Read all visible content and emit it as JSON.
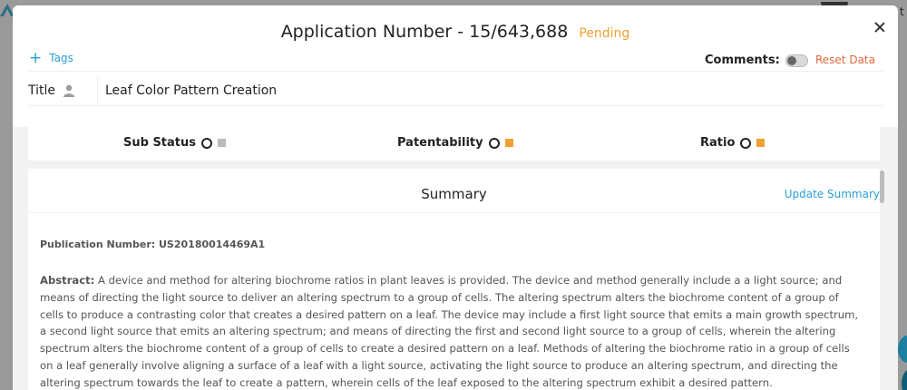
{
  "modal": {
    "title": "Application Number - 15/643,688",
    "status": "Pending",
    "tags_label": "Tags",
    "comments_label": "Comments:",
    "reset_label": "Reset Data",
    "title_label": "Title",
    "title_value": "Leaf Color Pattern Creation"
  },
  "partial_row": {
    "items": [
      "Sub Status",
      "Patentability",
      "Ratio"
    ]
  },
  "summary": {
    "heading": "Summary",
    "update_label": "Update Summary",
    "publication_label": "Publication Number:",
    "publication_value": "US20180014469A1",
    "abstract_label": "Abstract:",
    "abstract_text": "A device and method for altering biochrome ratios in plant leaves is provided. The device and method generally include a a light source; and means of directing the light source to deliver an altering spectrum to a group of cells. The altering spectrum alters the biochrome content of a group of cells to produce a contrasting color that creates a desired pattern on a leaf. The device may include a first light source that emits a main growth spectrum, a second light source that emits an altering spectrum; and means of directing the first and second light source to a group of cells, wherein the altering spectrum alters the biochrome content of a group of cells to create a desired pattern on a leaf. Methods of altering the biochrome ratio in a group of cells on a leaf generally involve aligning a surface of a leaf with a light source, activating the light source to produce an altering spectrum, and directing the altering spectrum towards the leaf to create a pattern, wherein cells of the leaf exposed to the altering spectrum exhibit a desired pattern."
  },
  "colors": {
    "accent_blue": "#2a9fd6",
    "pending_orange": "#f0a030",
    "reset_orange": "#e06a3a"
  },
  "icons": [
    "close-icon",
    "plus-icon",
    "person-icon",
    "info-icon",
    "edit-icon"
  ]
}
